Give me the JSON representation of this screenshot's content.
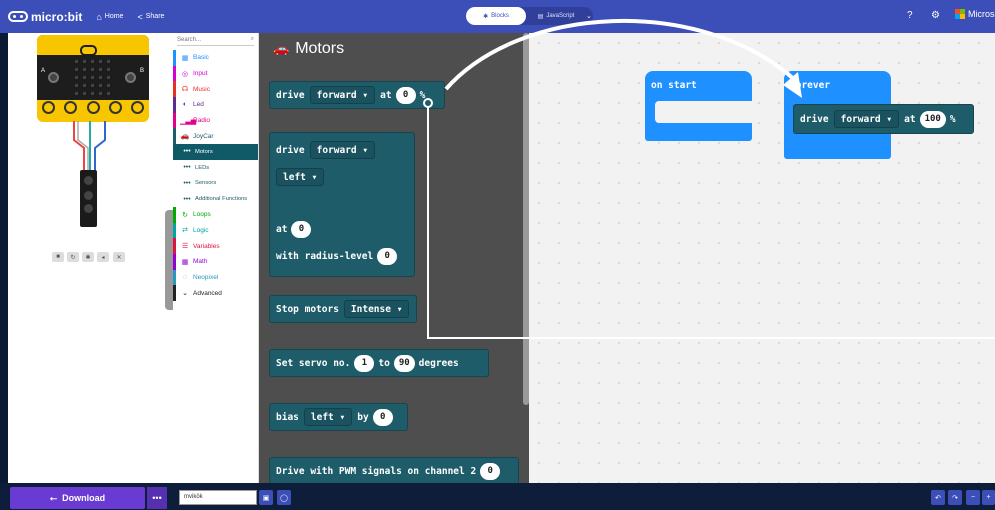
{
  "topbar": {
    "brand": "micro:bit",
    "home_label": "Home",
    "share_label": "Share",
    "blocks_label": "Blocks",
    "javascript_label": "JavaScript",
    "microsoft_label": "Microso"
  },
  "toolbox": {
    "search_placeholder": "Search...",
    "categories": [
      {
        "label": "Basic",
        "icon": "grid-icon",
        "color": "#1e90ff"
      },
      {
        "label": "Input",
        "icon": "target-icon",
        "color": "#d400d4"
      },
      {
        "label": "Music",
        "icon": "headphones-icon",
        "color": "#e63022"
      },
      {
        "label": "Led",
        "icon": "toggle-icon",
        "color": "#5c2d91"
      },
      {
        "label": "Radio",
        "icon": "signal-icon",
        "color": "#e3008c"
      },
      {
        "label": "JoyCar",
        "icon": "car-icon",
        "color": "#1f5c6a"
      },
      {
        "label": "Motors",
        "icon": "dots-icon",
        "color": "#1f5c6a"
      },
      {
        "label": "LEDs",
        "icon": "dots-icon",
        "color": "#1f5c6a"
      },
      {
        "label": "Sensors",
        "icon": "dots-icon",
        "color": "#1f5c6a"
      },
      {
        "label": "Additional Functions",
        "icon": "dots-icon",
        "color": "#1f5c6a"
      },
      {
        "label": "Loops",
        "icon": "loop-icon",
        "color": "#00aa00"
      },
      {
        "label": "Logic",
        "icon": "shuffle-icon",
        "color": "#00a4a6"
      },
      {
        "label": "Variables",
        "icon": "list-icon",
        "color": "#dc143c"
      },
      {
        "label": "Math",
        "icon": "calculator-icon",
        "color": "#9400d3"
      },
      {
        "label": "Neopixel",
        "icon": "neopixel-icon",
        "color": "#2699bf"
      },
      {
        "label": "Advanced",
        "icon": "chevron-down-icon",
        "color": "#222222"
      }
    ]
  },
  "flyout": {
    "title": "Motors",
    "block1": {
      "drive": "drive",
      "dir": "forward",
      "at": "at",
      "value": "0",
      "unit": "%"
    },
    "block2": {
      "drive": "drive",
      "dir": "forward",
      "side": "left",
      "at": "at",
      "value": "0",
      "radius": "with radius-level",
      "radius_value": "0"
    },
    "block3": {
      "label": "Stop motors",
      "mode": "Intense"
    },
    "block4": {
      "label": "Set servo no.",
      "servo": "1",
      "to": "to",
      "angle": "90",
      "unit": "degrees"
    },
    "block5": {
      "label": "bias",
      "dir": "left",
      "by": "by",
      "value": "0"
    },
    "block6": {
      "label": "Drive with PWM signals on channel 2",
      "value": "0"
    }
  },
  "workspace": {
    "on_start": "on start",
    "forever": "forever",
    "drive": "drive",
    "dir": "forward",
    "at": "at",
    "value": "100",
    "unit": "%"
  },
  "bottom": {
    "download_label": "Download",
    "more_label": "•••",
    "project_name": "mvikök"
  },
  "colors": {
    "topbar": "#3c4fb8",
    "joycar_block": "#1f5c6a",
    "basic_block": "#1e90ff",
    "download": "#6a3bd2"
  }
}
